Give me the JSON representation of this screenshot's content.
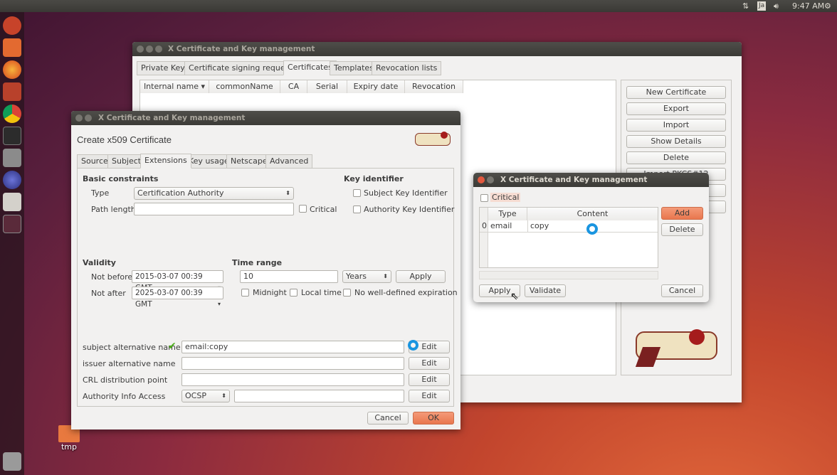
{
  "panel": {
    "keyboard": "Ja",
    "time": "9:47 AM",
    "icons": [
      "network-arrows-icon",
      "keyboard-layout-icon",
      "volume-icon",
      "gear-power-icon"
    ]
  },
  "launcher": {
    "items": [
      "ubuntu-dash-icon",
      "files-icon",
      "firefox-icon",
      "settings-icon",
      "chrome-icon",
      "terminal-icon",
      "camera-icon",
      "eclipse-icon",
      "xca-icon",
      "workspace-icon",
      "trash-icon"
    ]
  },
  "desktop": {
    "folder_label": "tmp"
  },
  "main_window": {
    "title": "X Certificate and Key management",
    "tabs": [
      "Private Keys",
      "Certificate signing requests",
      "Certificates",
      "Templates",
      "Revocation lists"
    ],
    "active_tab": 2,
    "columns": [
      "Internal name",
      "commonName",
      "CA",
      "Serial",
      "Expiry date",
      "Revocation"
    ],
    "buttons": [
      "New Certificate",
      "Export",
      "Import",
      "Show Details",
      "Delete",
      "Import PKCS#12",
      "",
      ""
    ]
  },
  "create_dialog": {
    "title": "X Certificate and Key management",
    "heading": "Create x509 Certificate",
    "tabs": [
      "Source",
      "Subject",
      "Extensions",
      "Key usage",
      "Netscape",
      "Advanced"
    ],
    "active_tab": 2,
    "basic": {
      "title": "Basic constraints",
      "type_label": "Type",
      "type_value": "Certification Authority",
      "path_label": "Path length",
      "path_value": "",
      "critical": "Critical"
    },
    "keyid": {
      "title": "Key identifier",
      "subject": "Subject Key Identifier",
      "authority": "Authority Key Identifier"
    },
    "validity": {
      "title": "Validity",
      "not_before_label": "Not before",
      "not_before": "2015-03-07 00:39 GMT",
      "not_after_label": "Not after",
      "not_after": "2025-03-07 00:39 GMT"
    },
    "time_range": {
      "title": "Time range",
      "value": "10",
      "unit": "Years",
      "apply": "Apply",
      "midnight": "Midnight",
      "local_time": "Local time",
      "no_expiration": "No well-defined expiration"
    },
    "ext": {
      "san_label": "subject alternative name",
      "san_value": "email:copy",
      "ian_label": "issuer alternative name",
      "ian_value": "",
      "crl_label": "CRL distribution point",
      "crl_value": "",
      "aia_label": "Authority Info Access",
      "aia_method": "OCSP",
      "aia_value": "",
      "edit": "Edit"
    },
    "cancel": "Cancel",
    "ok": "OK"
  },
  "edit_dialog": {
    "title": "X Certificate and Key management",
    "critical": "Critical",
    "columns": [
      "Type",
      "Content"
    ],
    "rows": [
      {
        "index": "0",
        "type": "email",
        "content": "copy"
      }
    ],
    "add": "Add",
    "delete": "Delete",
    "apply": "Apply",
    "validate": "Validate",
    "cancel": "Cancel"
  },
  "colors": {
    "accent": "#e9774e",
    "busy_cursor": "#1a95e0",
    "check": "#4caf1a"
  }
}
